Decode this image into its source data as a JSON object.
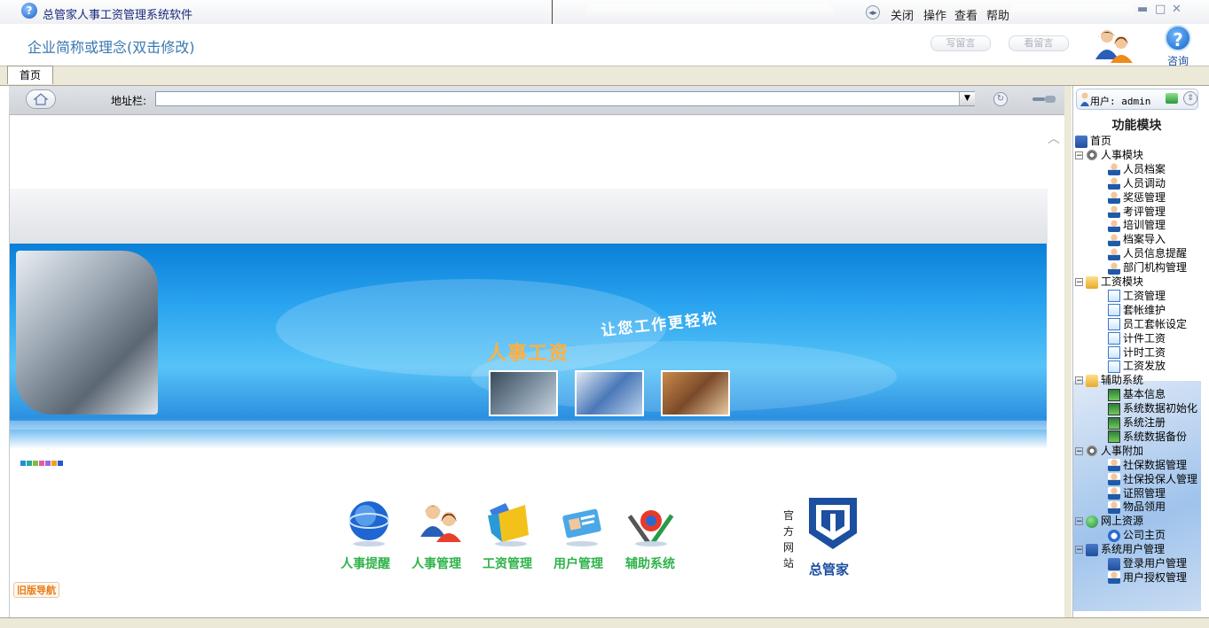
{
  "window": {
    "title": "总管家人事工资管理系统软件",
    "menu": [
      "关闭",
      "操作",
      "查看",
      "帮助"
    ]
  },
  "header": {
    "company": "企业简称或理念(双击修改)",
    "leave_message": "写留言",
    "view_message": "看留言",
    "help_label": "咨询"
  },
  "tabs": [
    "首页"
  ],
  "address": {
    "label": "地址栏:",
    "value": ""
  },
  "banner": {
    "slogan": "让您工作更轻松",
    "title": "人事工资"
  },
  "color_dots": [
    "#1f8fd6",
    "#2aa8a0",
    "#7ac143",
    "#e85aa0",
    "#9b6ad6",
    "#f0a020",
    "#1f5ad6"
  ],
  "nav": [
    {
      "label": "人事提醒",
      "icon": "globe-icon"
    },
    {
      "label": "人事管理",
      "icon": "users-icon"
    },
    {
      "label": "工资管理",
      "icon": "folder-icon"
    },
    {
      "label": "用户管理",
      "icon": "id-card-icon"
    },
    {
      "label": "辅助系统",
      "icon": "tools-icon"
    }
  ],
  "official_site": "官方网站",
  "logo_text": "总管家",
  "old_nav": "旧版导航",
  "sidebar": {
    "user": "用户: admin",
    "title": "功能模块",
    "tree": [
      {
        "label": "首页",
        "level": 0,
        "icon": "home"
      },
      {
        "label": "人事模块",
        "level": 0,
        "icon": "gear",
        "toggle": "⊟"
      },
      {
        "label": "人员档案",
        "level": 1,
        "icon": "person"
      },
      {
        "label": "人员调动",
        "level": 1,
        "icon": "person"
      },
      {
        "label": "奖惩管理",
        "level": 1,
        "icon": "person"
      },
      {
        "label": "考评管理",
        "level": 1,
        "icon": "person"
      },
      {
        "label": "培训管理",
        "level": 1,
        "icon": "person"
      },
      {
        "label": "档案导入",
        "level": 1,
        "icon": "person"
      },
      {
        "label": "人员信息提醒",
        "level": 1,
        "icon": "person"
      },
      {
        "label": "部门机构管理",
        "level": 1,
        "icon": "person"
      },
      {
        "label": "工资模块",
        "level": 0,
        "icon": "folder",
        "toggle": "⊟"
      },
      {
        "label": "工资管理",
        "level": 1,
        "icon": "doc"
      },
      {
        "label": "套帐维护",
        "level": 1,
        "icon": "doc"
      },
      {
        "label": "员工套帐设定",
        "level": 1,
        "icon": "doc"
      },
      {
        "label": "计件工资",
        "level": 1,
        "icon": "doc"
      },
      {
        "label": "计时工资",
        "level": 1,
        "icon": "doc"
      },
      {
        "label": "工资发放",
        "level": 1,
        "icon": "doc"
      },
      {
        "label": "辅助系统",
        "level": 0,
        "icon": "folder",
        "toggle": "⊟"
      },
      {
        "label": "基本信息",
        "level": 1,
        "icon": "monitor"
      },
      {
        "label": "系统数据初始化",
        "level": 1,
        "icon": "monitor"
      },
      {
        "label": "系统注册",
        "level": 1,
        "icon": "monitor"
      },
      {
        "label": "系统数据备份",
        "level": 1,
        "icon": "monitor"
      },
      {
        "label": "人事附加",
        "level": 0,
        "icon": "gear",
        "toggle": "⊟"
      },
      {
        "label": "社保数据管理",
        "level": 1,
        "icon": "person"
      },
      {
        "label": "社保投保人管理",
        "level": 1,
        "icon": "person"
      },
      {
        "label": "证照管理",
        "level": 1,
        "icon": "person"
      },
      {
        "label": "物品领用",
        "level": 1,
        "icon": "person"
      },
      {
        "label": "网上资源",
        "level": 0,
        "icon": "globe",
        "toggle": "⊟"
      },
      {
        "label": "公司主页",
        "level": 1,
        "icon": "e"
      },
      {
        "label": "系统用户管理",
        "level": 0,
        "icon": "home",
        "toggle": "⊟"
      },
      {
        "label": "登录用户管理",
        "level": 1,
        "icon": "home"
      },
      {
        "label": "用户授权管理",
        "level": 1,
        "icon": "person"
      }
    ]
  }
}
